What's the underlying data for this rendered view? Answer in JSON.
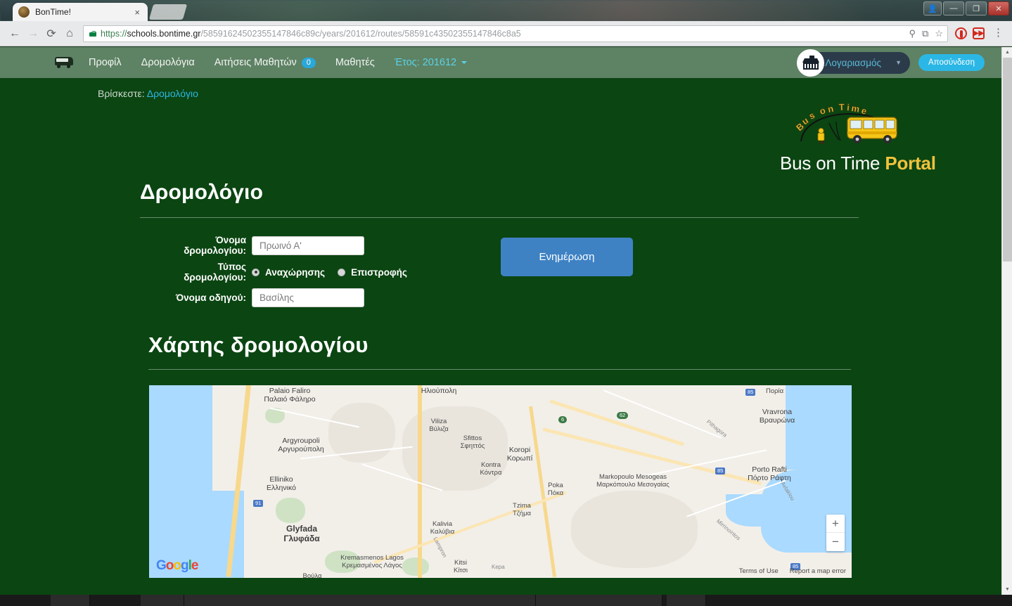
{
  "browser": {
    "tab_title": "BonTime!",
    "tab_close": "×",
    "back_icon": "←",
    "forward_icon": "→",
    "reload_icon": "⟳",
    "home_icon": "⌂",
    "url_scheme": "https://",
    "url_host": "schools.bontime.gr",
    "url_path": "/58591624502355147846c89c/years/201612/routes/58591c43502355147846c8a5",
    "url_full": "https://schools.bontime.gr/58591624502355147846c89c/years/201612/routes/58591c43502355147846c8a5",
    "zoom_icon": "⚲",
    "translate_icon": "⧉",
    "bookmark_icon": "☆",
    "menu_icon": "⋮",
    "win_minimize": "—",
    "win_maximize": "❐",
    "win_close": "✕",
    "win_user": "👤"
  },
  "navbar": {
    "brand_icon": "bus-icon",
    "items": [
      {
        "label": "Προφίλ"
      },
      {
        "label": "Δρομολόγια"
      },
      {
        "label": "Αιτήσεις Μαθητών",
        "badge": "0"
      },
      {
        "label": "Μαθητές"
      },
      {
        "label": "Έτος: 201612",
        "caret": true
      }
    ],
    "account_label": "Λογαριασμός",
    "logout_label": "Αποσύνδεση",
    "bg_color": "#5e8264",
    "accent_color": "#2bb7e5"
  },
  "breadcrumb": {
    "prefix": "Βρίσκεστε:",
    "current": "Δρομολόγιο"
  },
  "logo": {
    "arch_text": "Bus on Time",
    "title_main": "Bus on Time",
    "title_accent": "Portal",
    "accent_color": "#f0c23c"
  },
  "page": {
    "bg_color": "#0b4512",
    "heading": "Δρομολόγιο",
    "map_heading": "Χάρτης δρομολογίου"
  },
  "form": {
    "route_name_label": "Όνομα δρομολογίου:",
    "route_name_value": "Πρωινό Α'",
    "route_type_label": "Τύπος δρομολογίου:",
    "route_type_options": [
      {
        "label": "Αναχώρησης",
        "checked": true
      },
      {
        "label": "Επιστροφής",
        "checked": false
      }
    ],
    "driver_name_label": "Όνομα οδηγού:",
    "driver_name_value": "Βασίλης",
    "submit_label": "Ενημέρωση",
    "submit_color": "#3e82c4"
  },
  "map": {
    "provider_logo": "Google",
    "terms_label": "Terms of Use",
    "report_label": "Report a map error",
    "zoom_in": "+",
    "zoom_out": "−",
    "labels": [
      {
        "en": "Palaio Faliro",
        "gr": "Παλαιό Φάληρο"
      },
      {
        "en": "",
        "gr": "Ηλιούπολη"
      },
      {
        "en": "Argyroupoli",
        "gr": "Αργυρούπολη"
      },
      {
        "en": "Elliniko",
        "gr": "Ελληνικό"
      },
      {
        "en": "Glyfada",
        "gr": "Γλυφάδα"
      },
      {
        "en": "Kremasmenos Lagos",
        "gr": "Κρεμασμένος Λάγος"
      },
      {
        "en": "Viliza",
        "gr": "Βύλιζα"
      },
      {
        "en": "Sfittos",
        "gr": "Σφηττός"
      },
      {
        "en": "Kontra",
        "gr": "Κόντρα"
      },
      {
        "en": "Koropi",
        "gr": "Κορωπί"
      },
      {
        "en": "Poka",
        "gr": "Πόκα"
      },
      {
        "en": "Tzima",
        "gr": "Τζήμα"
      },
      {
        "en": "Kalivia",
        "gr": "Καλύβια"
      },
      {
        "en": "Kitsi",
        "gr": "Κίτσι"
      },
      {
        "en": "Markopoulo Mesogeas",
        "gr": "Μαρκόπουλο Μεσογαίας"
      },
      {
        "en": "Vravrona",
        "gr": "Βραυρώνα"
      },
      {
        "en": "Porto Rafti",
        "gr": "Πόρτο Ράφτη"
      },
      {
        "en": "",
        "gr": "Πορία"
      },
      {
        "en": "",
        "gr": "Βούλα"
      }
    ],
    "road_shields": [
      "91",
      "6",
      "62",
      "85",
      "85",
      "85"
    ],
    "street_names": [
      "Pithagora",
      "Lampron",
      "Kepa",
      "Avlakiou",
      "Mirrinointos"
    ]
  }
}
